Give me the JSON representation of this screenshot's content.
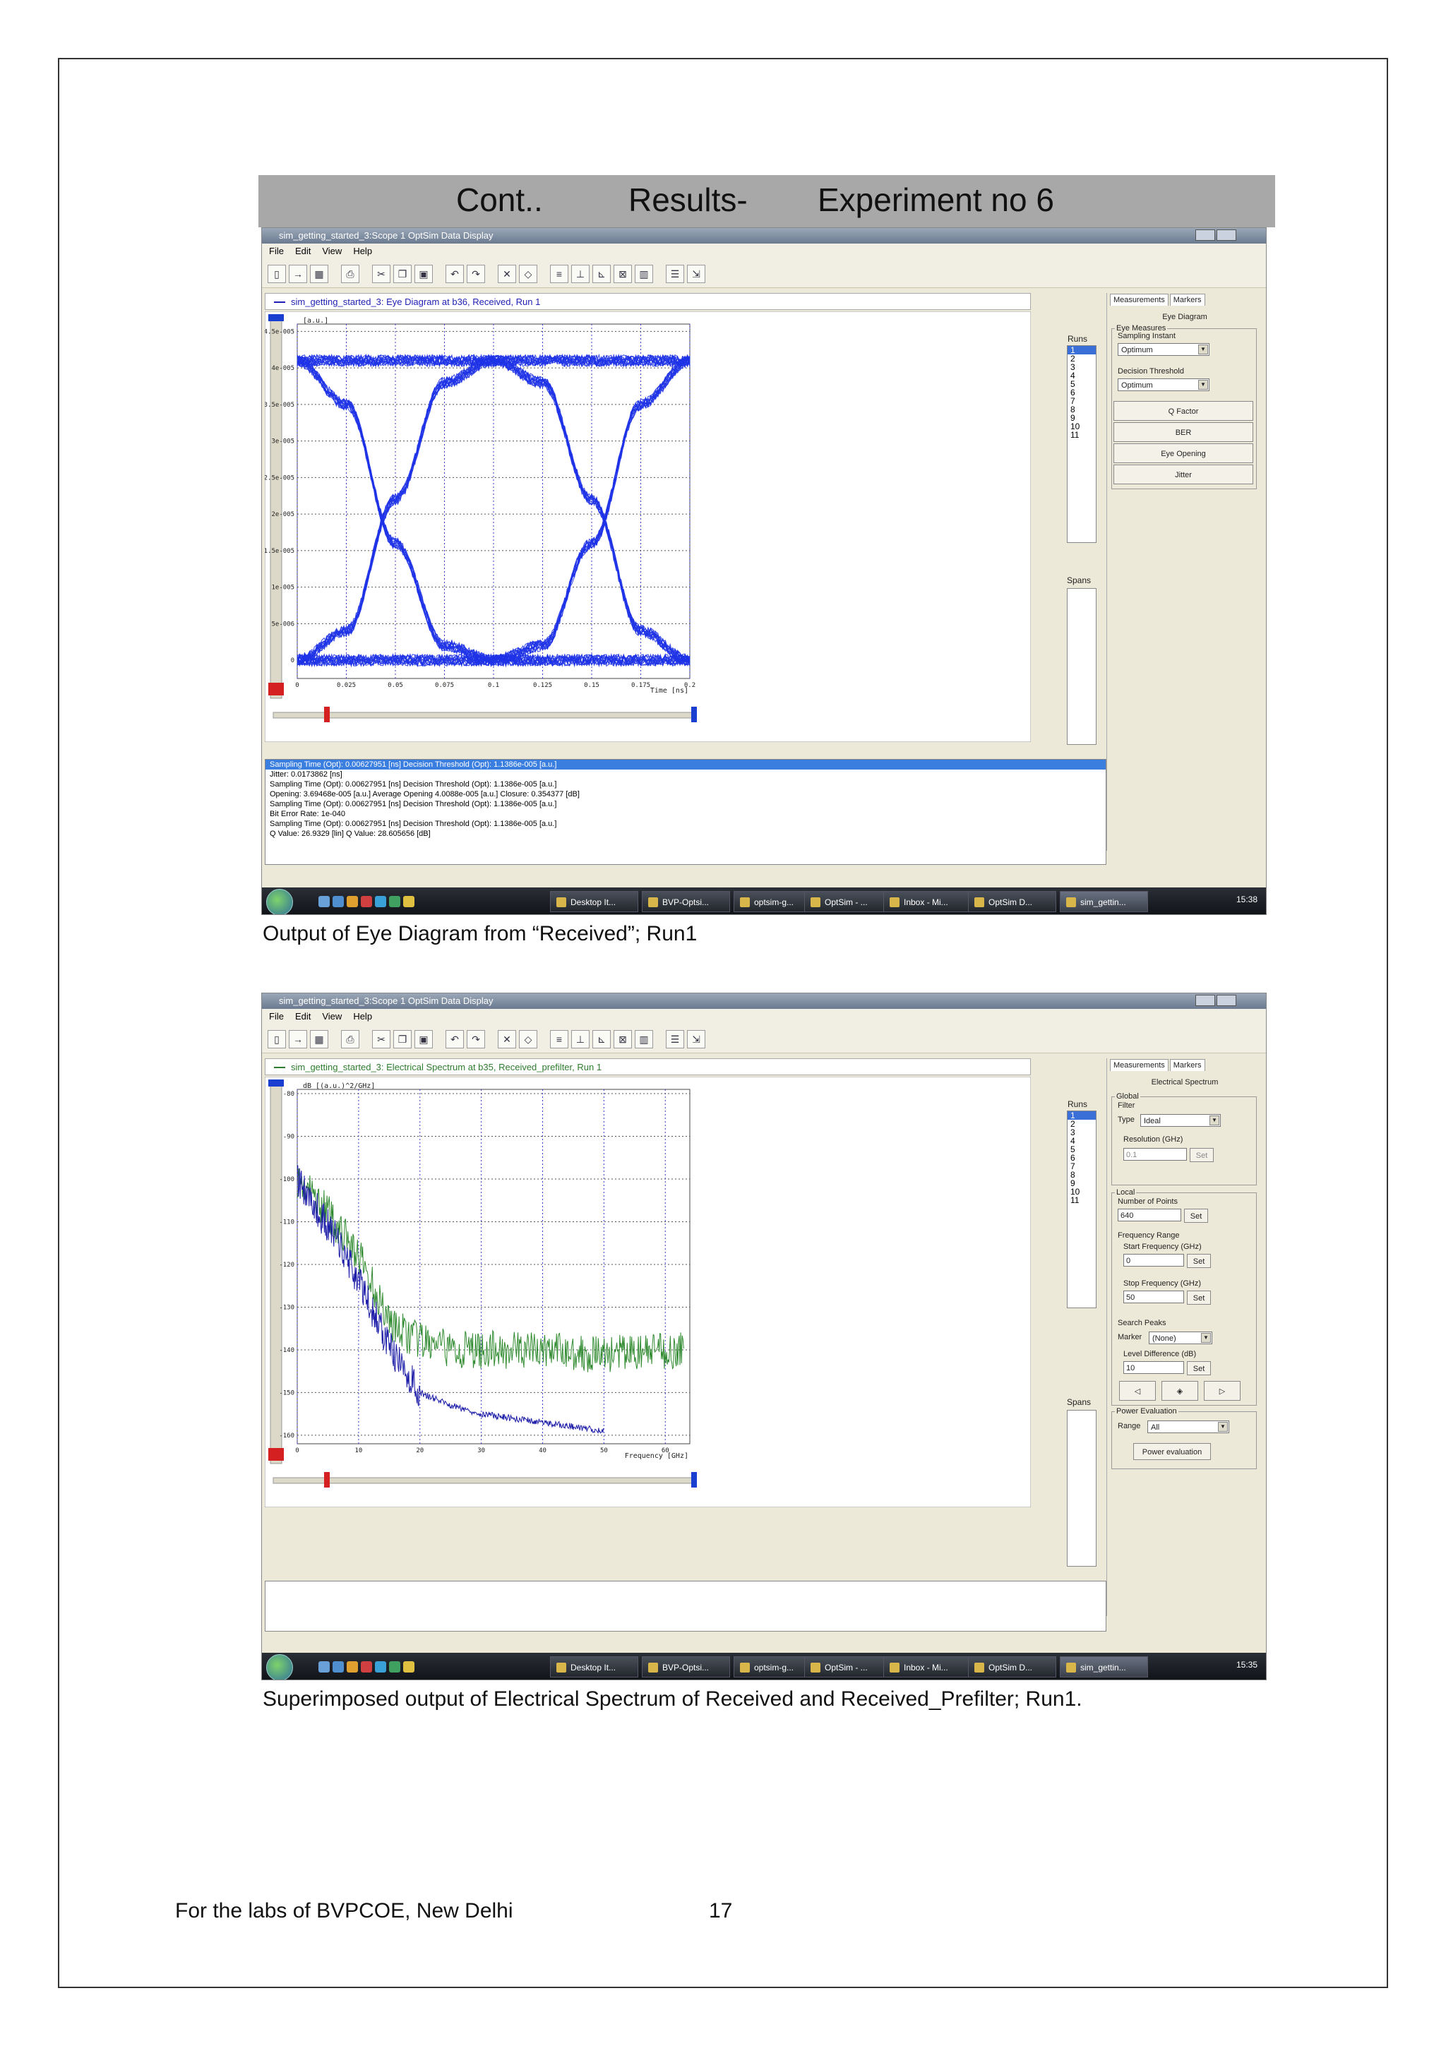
{
  "banner": {
    "left": "Cont..",
    "middle": "Results-",
    "right": "Experiment no 6"
  },
  "window_title": "sim_getting_started_3:Scope 1 OptSim Data Display",
  "menu": [
    "File",
    "Edit",
    "View",
    "Help"
  ],
  "taskbar": {
    "items": [
      "Desktop It...",
      "BVP-Optsi...",
      "optsim-g...",
      "OptSim - ...",
      "Inbox - Mi...",
      "OptSim D...",
      "sim_gettin..."
    ]
  },
  "shot1": {
    "tab_label": "sim_getting_started_3: Eye Diagram at b36, Received, Run 1",
    "tab_color": "#1f1fb4",
    "runs_label": "Runs",
    "runs": [
      "1",
      "2",
      "3",
      "4",
      "5",
      "6",
      "7",
      "8",
      "9",
      "10",
      "11"
    ],
    "spans_label": "Spans",
    "panel": {
      "tabs": [
        "Measurements",
        "Markers"
      ],
      "title": "Eye Diagram",
      "group": "Eye Measures",
      "sampling_label": "Sampling Instant",
      "sampling_value": "Optimum",
      "threshold_label": "Decision Threshold",
      "threshold_value": "Optimum",
      "buttons": [
        "Q Factor",
        "BER",
        "Eye Opening",
        "Jitter"
      ]
    },
    "output": [
      "Sampling Time (Opt): 0.00627951 [ns] Decision Threshold (Opt): 1.1386e-005 [a.u.]",
      "  Jitter: 0.0173862 [ns]",
      "Sampling Time (Opt): 0.00627951 [ns] Decision Threshold (Opt): 1.1386e-005 [a.u.]",
      "  Opening: 3.69468e-005 [a.u.] Average Opening 4.0088e-005 [a.u.] Closure: 0.354377 [dB]",
      "Sampling Time (Opt): 0.00627951 [ns] Decision Threshold (Opt): 1.1386e-005 [a.u.]",
      "  Bit Error Rate: 1e-040",
      "Sampling Time (Opt): 0.00627951 [ns] Decision Threshold (Opt): 1.1386e-005 [a.u.]",
      "  Q Value: 26.9329 [lin] Q Value: 28.605656 [dB]"
    ],
    "clock": "15:38",
    "caption": "Output of Eye Diagram from “Received”; Run1"
  },
  "shot2": {
    "tab_label": "sim_getting_started_3: Electrical Spectrum at b35, Received_prefilter, Run 1",
    "tab_color": "#2e7d2e",
    "runs_label": "Runs",
    "runs": [
      "1",
      "2",
      "3",
      "4",
      "5",
      "6",
      "7",
      "8",
      "9",
      "10",
      "11"
    ],
    "spans_label": "Spans",
    "panel": {
      "tabs": [
        "Measurements",
        "Markers"
      ],
      "title": "Electrical Spectrum",
      "global": "Global",
      "filter": "Filter",
      "type_label": "Type",
      "type_value": "Ideal",
      "resolution_label": "Resolution (GHz)",
      "resolution_value": "0.1",
      "set": "Set",
      "local": "Local",
      "points_label": "Number of Points",
      "points_value": "640",
      "freq_range": "Frequency Range",
      "start_label": "Start Frequency (GHz)",
      "start_value": "0",
      "stop_label": "Stop Frequency (GHz)",
      "stop_value": "50",
      "search_peaks": "Search Peaks",
      "marker_label": "Marker",
      "marker_value": "(None)",
      "level_label": "Level Difference (dB)",
      "level_value": "10",
      "power_eval": "Power Evaluation",
      "range_label": "Range",
      "range_value": "All",
      "power_button": "Power evaluation"
    },
    "clock": "15:35",
    "caption": "Superimposed output of Electrical Spectrum of Received and Received_Prefilter; Run1."
  },
  "chart_data": [
    {
      "type": "line",
      "title": "",
      "ylabel": "[a.u.]",
      "xlabel": "Time [ns]",
      "xlim": [
        0,
        0.2
      ],
      "ylim": [
        -2.5e-06,
        4.6e-05
      ],
      "x_ticks": [
        "0",
        "0.025",
        "0.05",
        "0.075",
        "0.1",
        "0.125",
        "0.15",
        "0.175",
        "0.2"
      ],
      "y_ticks": [
        "0",
        "5e-006",
        "1e-005",
        "1.5e-005",
        "2e-005",
        "2.5e-005",
        "3e-005",
        "3.5e-005",
        "4e-005",
        "4.5e-005"
      ],
      "grid": true,
      "series_color": "#1e32e6",
      "series": [
        {
          "x": [
            0,
            0.025,
            0.05,
            0.075,
            0.1,
            0.125,
            0.15,
            0.175,
            0.2
          ],
          "values": [
            4.1e-05,
            3.5e-05,
            1.6e-05,
            2e-06,
            0,
            2e-06,
            1.6e-05,
            3.5e-05,
            4.1e-05
          ]
        },
        {
          "x": [
            0,
            0.025,
            0.05,
            0.075,
            0.1,
            0.125,
            0.15,
            0.175,
            0.2
          ],
          "values": [
            0,
            4e-06,
            2.2e-05,
            3.8e-05,
            4.1e-05,
            3.8e-05,
            2.2e-05,
            4e-06,
            0
          ]
        },
        {
          "x": [
            0,
            0.2
          ],
          "values": [
            4.1e-05,
            4.1e-05
          ]
        },
        {
          "x": [
            0,
            0.2
          ],
          "values": [
            0,
            0
          ]
        }
      ]
    },
    {
      "type": "line",
      "title": "",
      "ylabel": "dB [(a.u.)^2/GHz]",
      "xlabel": "Frequency [GHz]",
      "xlim": [
        0,
        64
      ],
      "ylim": [
        -162,
        -79
      ],
      "x_ticks": [
        "0",
        "10",
        "20",
        "30",
        "40",
        "50",
        "60"
      ],
      "y_ticks": [
        "-80",
        "-90",
        "-100",
        "-110",
        "-120",
        "-130",
        "-140",
        "-150",
        "-160"
      ],
      "grid": true,
      "series": [
        {
          "color": "#2f8a2f",
          "x": [
            0,
            2,
            4,
            6,
            8,
            10,
            12,
            14,
            16,
            20,
            25,
            30,
            40,
            50,
            63
          ],
          "values": [
            -100,
            -103,
            -106,
            -110,
            -114,
            -118,
            -124,
            -130,
            -135,
            -138,
            -140,
            -140,
            -140,
            -141,
            -140
          ]
        },
        {
          "color": "#1c1ca8",
          "x": [
            0,
            2,
            4,
            6,
            8,
            10,
            12,
            14,
            16,
            20,
            25,
            30,
            35,
            40,
            45,
            50
          ],
          "values": [
            -100,
            -104,
            -109,
            -113,
            -118,
            -124,
            -130,
            -136,
            -142,
            -150,
            -153,
            -155,
            -156,
            -157,
            -158,
            -159
          ]
        }
      ]
    }
  ]
}
